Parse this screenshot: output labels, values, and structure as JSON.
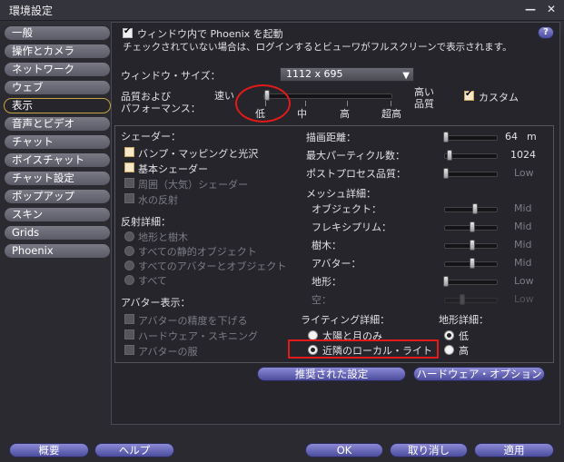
{
  "window": {
    "title": "環境設定",
    "minimize": "—",
    "close": "✕"
  },
  "sidebar": {
    "items": [
      {
        "label": "一般"
      },
      {
        "label": "操作とカメラ"
      },
      {
        "label": "ネットワーク"
      },
      {
        "label": "ウェブ"
      },
      {
        "label": "表示"
      },
      {
        "label": "音声とビデオ"
      },
      {
        "label": "チャット"
      },
      {
        "label": "ボイスチャット"
      },
      {
        "label": "チャット設定"
      },
      {
        "label": "ポップアップ"
      },
      {
        "label": "スキン"
      },
      {
        "label": "Grids"
      },
      {
        "label": "Phoenix"
      }
    ]
  },
  "display": {
    "fullscreen_checkbox": "ウィンドウ内で Phoenix を起動",
    "fullscreen_note": "チェックされていない場合は、ログインするとビューワがフルスクリーンで表示されます。",
    "help": "?",
    "window_size_label": "ウィンドウ・サイズ：",
    "window_size_value": "1112 x 695",
    "quality_label_1": "品質および",
    "quality_label_2": "パフォーマンス：",
    "fast": "速い",
    "high_quality_1": "高い",
    "high_quality_2": "品質",
    "custom": "カスタム",
    "level_low": "低",
    "level_mid": "中",
    "level_high": "高",
    "level_ultra": "超高",
    "quality_level": 0
  },
  "shaders": {
    "header": "シェーダー：",
    "bump": "バンプ・マッピングと光沢",
    "basic": "基本シェーダー",
    "atmos": "周囲（大気）シェーダー",
    "water": "水の反射"
  },
  "reflection": {
    "header": "反射詳細：",
    "opt1": "地形と樹木",
    "opt2": "すべての静的オブジェクト",
    "opt3": "すべてのアバターとオブジェクト",
    "opt4": "すべて"
  },
  "avatar": {
    "header": "アバター表示：",
    "opt1": "アバターの精度を下げる",
    "opt2": "ハードウェア・スキニング",
    "opt3": "アバターの服"
  },
  "draw": {
    "distance_label": "描画距離：",
    "distance_value": "64",
    "distance_unit": "m",
    "particles_label": "最大パーティクル数：",
    "particles_value": "1024",
    "postprocess_label": "ポストプロセス品質：",
    "postprocess_value": "Low"
  },
  "mesh": {
    "header": "メッシュ詳細：",
    "rows": [
      {
        "label": "オブジェクト：",
        "value": "Mid"
      },
      {
        "label": "フレキシプリム：",
        "value": "Mid"
      },
      {
        "label": "樹木：",
        "value": "Mid"
      },
      {
        "label": "アバター：",
        "value": "Mid"
      },
      {
        "label": "地形：",
        "value": "Low"
      },
      {
        "label": "空：",
        "value": "Low"
      }
    ]
  },
  "lighting": {
    "header": "ライティング詳細：",
    "opt1": "太陽と月のみ",
    "opt2": "近隣のローカル・ライト"
  },
  "terrain": {
    "header": "地形詳細：",
    "opt1": "低",
    "opt2": "高"
  },
  "panel_buttons": {
    "recommended": "推奨された設定",
    "hardware": "ハードウェア・オプション"
  },
  "footer": {
    "about": "概要",
    "help": "ヘルプ",
    "ok": "OK",
    "cancel": "取り消し",
    "apply": "適用"
  },
  "colors": {
    "accent": "#c2a544",
    "annotation": "#e21a1a",
    "button": "#6a6ac0"
  }
}
